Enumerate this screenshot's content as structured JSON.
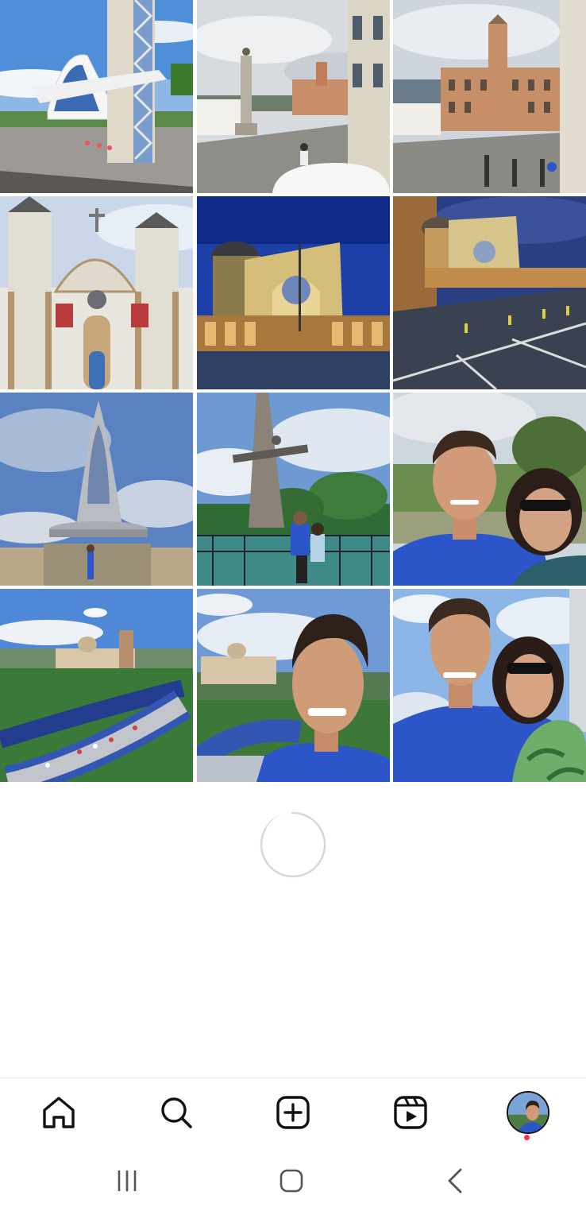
{
  "grid": {
    "posts": [
      {
        "name": "post-modern-chapel"
      },
      {
        "name": "post-town-square-column"
      },
      {
        "name": "post-colonial-museum-square"
      },
      {
        "name": "post-baroque-church"
      },
      {
        "name": "post-basilica-night"
      },
      {
        "name": "post-basilica-plaza"
      },
      {
        "name": "post-statue-mantle"
      },
      {
        "name": "post-tower-sculpture-couple"
      },
      {
        "name": "post-couple-selfie-garden"
      },
      {
        "name": "post-walkway-basilica-aerial"
      },
      {
        "name": "post-man-selfie-basilica"
      },
      {
        "name": "post-couple-selfie-sky"
      }
    ]
  },
  "loading": {
    "icon": "loading-spinner-icon"
  },
  "bottom_nav": {
    "items": [
      "home-icon",
      "search-icon",
      "create-post-icon",
      "reels-icon",
      "profile-avatar"
    ],
    "notification_color": "#ff2d55"
  },
  "system_nav": {
    "items": [
      "recent-apps-icon",
      "home-button-icon",
      "back-icon"
    ]
  },
  "colors": {
    "accent": "#2b5fd9",
    "shirt_blue": "#2b55c8"
  }
}
